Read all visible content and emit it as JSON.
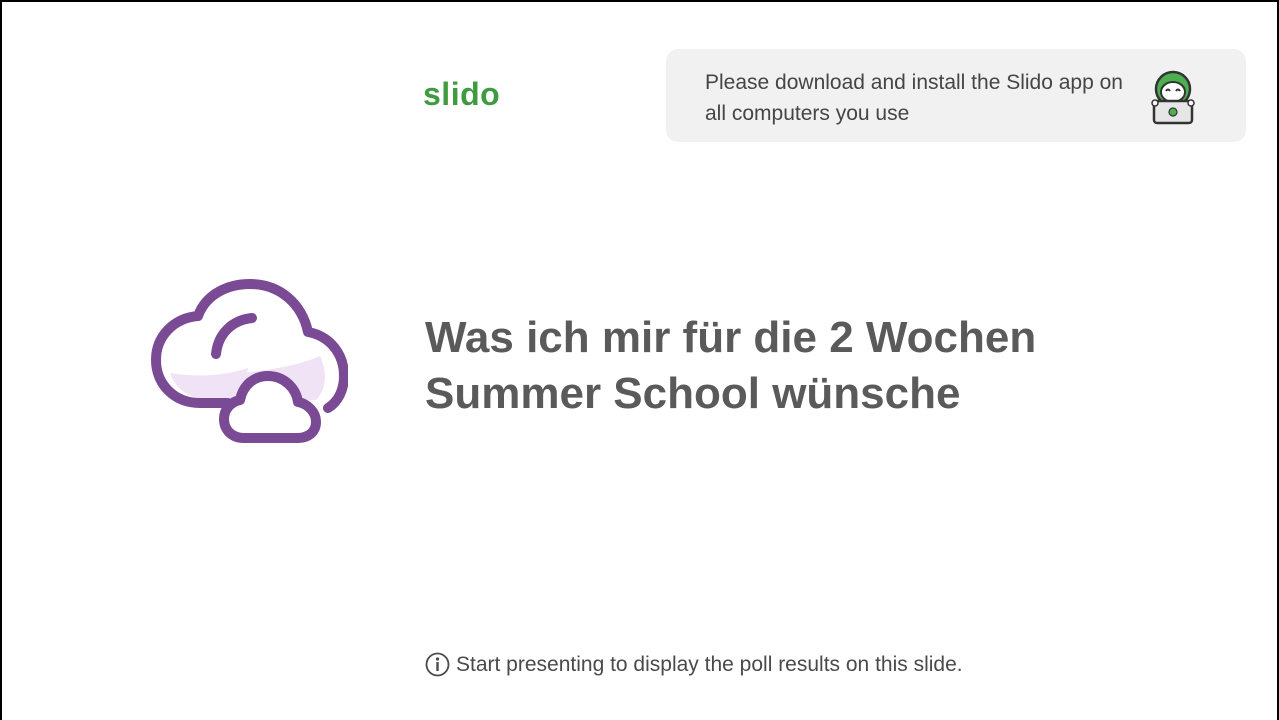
{
  "brand": {
    "logo_text": "slido",
    "color": "#3f9b3f"
  },
  "banner": {
    "message": "Please download and install the Slido app on all computers you use",
    "background": "#f1f1f1"
  },
  "poll": {
    "title": "Was ich mir für die 2 Wochen Summer School wünsche",
    "icon": "word-cloud-icon",
    "icon_color": "#7b4a94",
    "icon_fill": "#efe3f5"
  },
  "footer": {
    "icon": "info-icon",
    "text": "Start presenting to display the poll results on this slide."
  }
}
